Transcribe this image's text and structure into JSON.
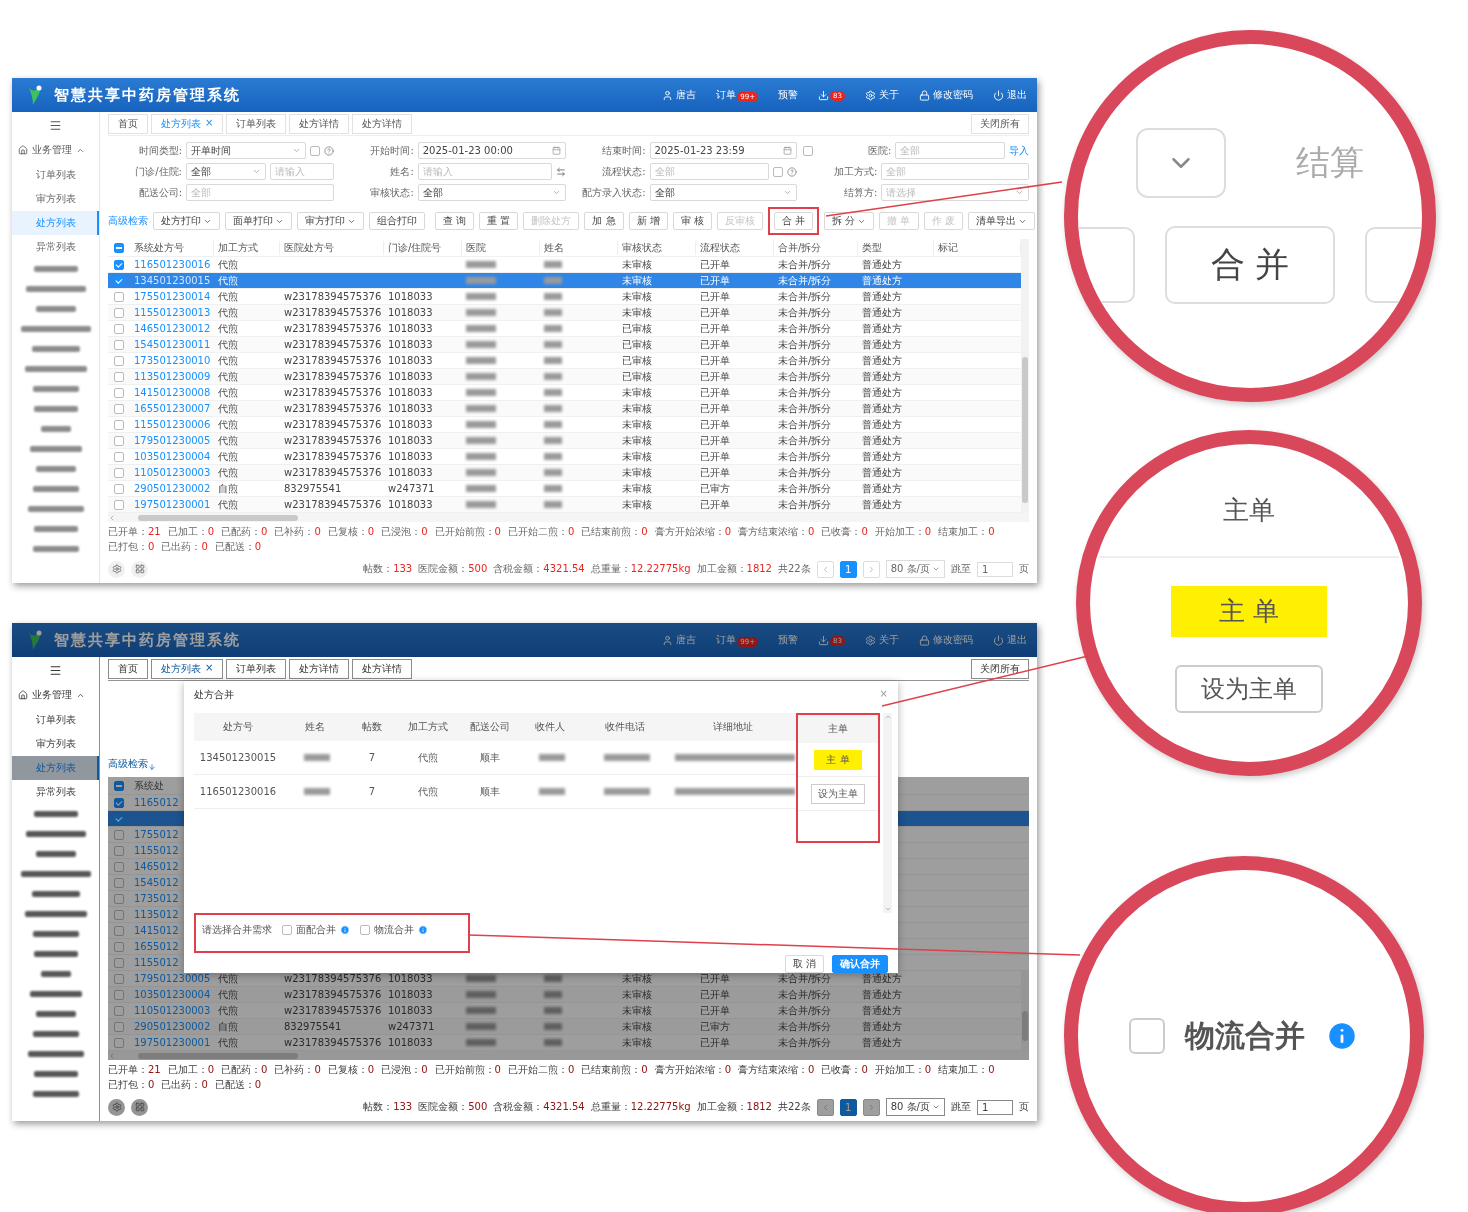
{
  "screenshots": [
    {
      "header": {
        "title": "智慧共享中药房管理系统",
        "items": [
          {
            "kind": "user",
            "label": "唐吉"
          },
          {
            "kind": "text",
            "label": "订单",
            "badge": "99+"
          },
          {
            "kind": "text",
            "label": "预警"
          },
          {
            "kind": "download",
            "badge": "83"
          },
          {
            "kind": "about",
            "label": "关于"
          },
          {
            "kind": "password",
            "label": "修改密码"
          },
          {
            "kind": "logout",
            "label": "退出"
          }
        ]
      },
      "sidebar": {
        "group": {
          "label": "业务管理",
          "expanded": true
        },
        "items": [
          {
            "label": "订单列表",
            "selected": false
          },
          {
            "label": "审方列表",
            "selected": false
          },
          {
            "label": "处方列表",
            "selected": true
          },
          {
            "label": "异常列表",
            "selected": false
          }
        ]
      },
      "tabs": [
        {
          "label": "首页",
          "selected": false
        },
        {
          "label": "处方列表",
          "selected": true,
          "close": "×"
        },
        {
          "label": "订单列表",
          "selected": false
        },
        {
          "label": "处方详情",
          "selected": false
        },
        {
          "label": "处方详情",
          "selected": false
        }
      ],
      "close_all": "关闭所有",
      "filters": [
        [
          {
            "label": "时间类型:",
            "kind": "select",
            "value": "开单时间",
            "extras": [
              {
                "kind": "checkbox",
                "checked": false
              },
              {
                "kind": "help"
              }
            ]
          },
          {
            "label": "开始时间:",
            "kind": "date",
            "value": "2025-01-23 00:00"
          },
          {
            "label": "结束时间:",
            "kind": "date",
            "value": "2025-01-23 23:59"
          },
          {
            "label": "医院:",
            "lead_checkbox": {
              "checked": false
            },
            "kind": "input",
            "placeholder": "全部",
            "extras": [
              {
                "kind": "link",
                "label": "导入"
              }
            ]
          }
        ],
        [
          {
            "label": "门诊/住院:",
            "kind": "select",
            "value": "全部",
            "extras": [
              {
                "kind": "input",
                "placeholder": "请输入"
              }
            ]
          },
          {
            "label": "姓名:",
            "kind": "input",
            "placeholder": "请输入",
            "extras": [
              {
                "kind": "swap"
              }
            ]
          },
          {
            "label": "流程状态:",
            "kind": "input",
            "placeholder": "全部",
            "extras": [
              {
                "kind": "checkbox",
                "checked": false
              },
              {
                "kind": "help"
              }
            ]
          },
          {
            "label": "加工方式:",
            "kind": "input",
            "placeholder": "全部"
          }
        ],
        [
          {
            "label": "配送公司:",
            "kind": "input",
            "placeholder": "全部"
          },
          {
            "label": "审核状态:",
            "kind": "select",
            "value": "全部"
          },
          {
            "label": "配方录入状态:",
            "kind": "select",
            "value": "全部"
          },
          {
            "label": "结算方:",
            "kind": "select",
            "placeholder": "请选择"
          }
        ]
      ],
      "toolbar": {
        "advanced": "高级检索",
        "left": [
          {
            "label": "处方打印",
            "dropdown": true
          },
          {
            "label": "面单打印",
            "dropdown": true
          },
          {
            "label": "审方打印",
            "dropdown": true
          },
          {
            "label": "组合打印",
            "dropdown": false
          }
        ],
        "right": [
          {
            "label": "查 询",
            "disabled": false
          },
          {
            "label": "重 置",
            "disabled": false
          },
          {
            "label": "删除处方",
            "disabled": true
          },
          {
            "label": "加 急",
            "disabled": false
          },
          {
            "label": "新 增",
            "disabled": false
          },
          {
            "label": "审 核",
            "disabled": false
          },
          {
            "label": "反审核",
            "disabled": true
          },
          {
            "label": "合 并",
            "disabled": false,
            "highlight": true
          },
          {
            "label": "拆 分",
            "disabled": false,
            "dropdown": true
          },
          {
            "label": "撤 单",
            "disabled": true
          },
          {
            "label": "作 废",
            "disabled": true
          },
          {
            "label": "清单导出",
            "disabled": false,
            "dropdown": true
          }
        ]
      },
      "table": {
        "indeterminate": true,
        "columns": [
          "系统处方号",
          "加工方式",
          "医院处方号",
          "门诊/住院号",
          "医院",
          "姓名",
          "审核状态",
          "流程状态",
          "合并/拆分",
          "类型",
          "标记"
        ],
        "rows": [
          {
            "id": "116501230016",
            "method": "代煎",
            "audit": "未审核",
            "flow": "已开单",
            "merge": "未合并/拆分",
            "type": "普通处方",
            "checked": true,
            "selected": false
          },
          {
            "id": "134501230015",
            "method": "代煎",
            "audit": "未审核",
            "flow": "已开单",
            "merge": "未合并/拆分",
            "type": "普通处方",
            "checked": true,
            "selected": true
          },
          {
            "id": "175501230014",
            "method": "代煎",
            "hosp_no": "w23178394575376",
            "visit_no": "1018033",
            "audit": "未审核",
            "flow": "已开单",
            "merge": "未合并/拆分",
            "type": "普通处方",
            "checked": false,
            "selected": false
          },
          {
            "id": "115501230013",
            "method": "代煎",
            "hosp_no": "w23178394575376",
            "visit_no": "1018033",
            "audit": "未审核",
            "flow": "已开单",
            "merge": "未合并/拆分",
            "type": "普通处方",
            "checked": false,
            "selected": false
          },
          {
            "id": "146501230012",
            "method": "代煎",
            "hosp_no": "w23178394575376",
            "visit_no": "1018033",
            "audit": "已审核",
            "flow": "已开单",
            "merge": "未合并/拆分",
            "type": "普通处方",
            "checked": false,
            "selected": false
          },
          {
            "id": "154501230011",
            "method": "代煎",
            "hosp_no": "w23178394575376",
            "visit_no": "1018033",
            "audit": "已审核",
            "flow": "已开单",
            "merge": "未合并/拆分",
            "type": "普通处方",
            "checked": false,
            "selected": false
          },
          {
            "id": "173501230010",
            "method": "代煎",
            "hosp_no": "w23178394575376",
            "visit_no": "1018033",
            "audit": "已审核",
            "flow": "已开单",
            "merge": "未合并/拆分",
            "type": "普通处方",
            "checked": false,
            "selected": false
          },
          {
            "id": "113501230009",
            "method": "代煎",
            "hosp_no": "w23178394575376",
            "visit_no": "1018033",
            "audit": "已审核",
            "flow": "已开单",
            "merge": "未合并/拆分",
            "type": "普通处方",
            "checked": false,
            "selected": false
          },
          {
            "id": "141501230008",
            "method": "代煎",
            "hosp_no": "w23178394575376",
            "visit_no": "1018033",
            "audit": "未审核",
            "flow": "已开单",
            "merge": "未合并/拆分",
            "type": "普通处方",
            "checked": false,
            "selected": false
          },
          {
            "id": "165501230007",
            "method": "代煎",
            "hosp_no": "w23178394575376",
            "visit_no": "1018033",
            "audit": "未审核",
            "flow": "已开单",
            "merge": "未合并/拆分",
            "type": "普通处方",
            "checked": false,
            "selected": false
          },
          {
            "id": "115501230006",
            "method": "代煎",
            "hosp_no": "w23178394575376",
            "visit_no": "1018033",
            "audit": "未审核",
            "flow": "已开单",
            "merge": "未合并/拆分",
            "type": "普通处方",
            "checked": false,
            "selected": false
          },
          {
            "id": "179501230005",
            "method": "代煎",
            "hosp_no": "w23178394575376",
            "visit_no": "1018033",
            "audit": "未审核",
            "flow": "已开单",
            "merge": "未合并/拆分",
            "type": "普通处方",
            "checked": false,
            "selected": false
          },
          {
            "id": "103501230004",
            "method": "代煎",
            "hosp_no": "w23178394575376",
            "visit_no": "1018033",
            "audit": "未审核",
            "flow": "已开单",
            "merge": "未合并/拆分",
            "type": "普通处方",
            "checked": false,
            "selected": false
          },
          {
            "id": "110501230003",
            "method": "代煎",
            "hosp_no": "w23178394575376",
            "visit_no": "1018033",
            "audit": "未审核",
            "flow": "已开单",
            "merge": "未合并/拆分",
            "type": "普通处方",
            "checked": false,
            "selected": false
          },
          {
            "id": "290501230002",
            "method": "自煎",
            "hosp_no": "832975541",
            "visit_no": "w247371",
            "audit": "未审核",
            "flow": "已审方",
            "merge": "未合并/拆分",
            "type": "普通处方",
            "checked": false,
            "selected": false
          },
          {
            "id": "197501230001",
            "method": "代煎",
            "hosp_no": "w23178394575376",
            "visit_no": "1018033",
            "audit": "未审核",
            "flow": "已开单",
            "merge": "未合并/拆分",
            "type": "普通处方",
            "checked": false,
            "selected": false
          }
        ]
      },
      "summary": [
        {
          "label": "已开单：",
          "value": "21"
        },
        {
          "label": "已加工：",
          "value": "0"
        },
        {
          "label": "已配药：",
          "value": "0"
        },
        {
          "label": "已补药：",
          "value": "0"
        },
        {
          "label": "已复核：",
          "value": "0"
        },
        {
          "label": "已浸泡：",
          "value": "0"
        },
        {
          "label": "已开始前煎：",
          "value": "0"
        },
        {
          "label": "已开始二煎：",
          "value": "0"
        },
        {
          "label": "已结束前煎：",
          "value": "0"
        },
        {
          "label": "膏方开始浓缩：",
          "value": "0"
        },
        {
          "label": "膏方结束浓缩：",
          "value": "0"
        },
        {
          "label": "已收膏：",
          "value": "0"
        },
        {
          "label": "开始加工：",
          "value": "0"
        },
        {
          "label": "结束加工：",
          "value": "0"
        },
        {
          "label": "已打包：",
          "value": "0"
        },
        {
          "label": "已出药：",
          "value": "0"
        },
        {
          "label": "已配送：",
          "value": "0"
        }
      ],
      "footer": {
        "stats": [
          {
            "label": "帖数：",
            "value": "133"
          },
          {
            "label": "医院金额：",
            "value": "500"
          },
          {
            "label": "含税金额：",
            "value": "4321.54"
          },
          {
            "label": "总重量：",
            "value": "12.22775kg"
          },
          {
            "label": "加工金额：",
            "value": "1812"
          }
        ],
        "total": "共22条",
        "page": "1",
        "page_size": "80 条/页",
        "jump_label": "跳至",
        "jump_value": "1",
        "jump_unit": "页"
      }
    },
    {
      "header": {
        "title": "智慧共享中药房管理系统",
        "items": [
          {
            "kind": "user",
            "label": "唐吉"
          },
          {
            "kind": "text",
            "label": "订单",
            "badge": "99+"
          },
          {
            "kind": "text",
            "label": "预警"
          },
          {
            "kind": "download",
            "badge": "83"
          },
          {
            "kind": "about",
            "label": "关于"
          },
          {
            "kind": "password",
            "label": "修改密码"
          },
          {
            "kind": "logout",
            "label": "退出"
          }
        ]
      },
      "sidebar": {
        "group": {
          "label": "业务管理",
          "expanded": true
        },
        "items": [
          {
            "label": "订单列表",
            "selected": false
          },
          {
            "label": "审方列表",
            "selected": false
          },
          {
            "label": "处方列表",
            "selected": true
          },
          {
            "label": "异常列表",
            "selected": false
          }
        ]
      },
      "tabs": [
        {
          "label": "首页",
          "selected": false
        },
        {
          "label": "处方列表",
          "selected": true,
          "close": "×"
        },
        {
          "label": "订单列表",
          "selected": false
        },
        {
          "label": "处方详情",
          "selected": false
        },
        {
          "label": "处方详情",
          "selected": false
        }
      ],
      "close_all": "关闭所有",
      "covered": {
        "advanced": "高级检索",
        "header_fragment": "系统处",
        "rows": [
          {
            "id": "1165012",
            "checked": true,
            "selected": false
          },
          {
            "checked": true,
            "selected": true
          },
          {
            "id": "1755012",
            "checked": false,
            "selected": false
          },
          {
            "id": "1155012",
            "checked": false,
            "selected": false
          },
          {
            "id": "1465012",
            "checked": false,
            "selected": false
          },
          {
            "id": "1545012",
            "checked": false,
            "selected": false
          },
          {
            "id": "1735012",
            "checked": false,
            "selected": false
          },
          {
            "id": "1135012",
            "checked": false,
            "selected": false
          },
          {
            "id": "1415012",
            "checked": false,
            "selected": false
          },
          {
            "id": "1655012",
            "checked": false,
            "selected": false
          },
          {
            "id": "1155012",
            "checked": false,
            "selected": false
          }
        ]
      },
      "table": {
        "rows": [
          {
            "id": "179501230005",
            "method": "代煎",
            "hosp_no": "w23178394575376",
            "visit_no": "1018033",
            "audit": "未审核",
            "flow": "已开单",
            "merge": "未合并/拆分",
            "type": "普通处方",
            "checked": false,
            "selected": false
          },
          {
            "id": "103501230004",
            "method": "代煎",
            "hosp_no": "w23178394575376",
            "visit_no": "1018033",
            "audit": "未审核",
            "flow": "已开单",
            "merge": "未合并/拆分",
            "type": "普通处方",
            "checked": false,
            "selected": false
          },
          {
            "id": "110501230003",
            "method": "代煎",
            "hosp_no": "w23178394575376",
            "visit_no": "1018033",
            "audit": "未审核",
            "flow": "已开单",
            "merge": "未合并/拆分",
            "type": "普通处方",
            "checked": false,
            "selected": false
          },
          {
            "id": "290501230002",
            "method": "自煎",
            "hosp_no": "832975541",
            "visit_no": "w247371",
            "audit": "未审核",
            "flow": "已审方",
            "merge": "未合并/拆分",
            "type": "普通处方",
            "checked": false,
            "selected": false
          },
          {
            "id": "197501230001",
            "method": "代煎",
            "hosp_no": "w23178394575376",
            "visit_no": "1018033",
            "audit": "未审核",
            "flow": "已开单",
            "merge": "未合并/拆分",
            "type": "普通处方",
            "checked": false,
            "selected": false
          }
        ]
      },
      "summary": [
        {
          "label": "已开单：",
          "value": "21"
        },
        {
          "label": "已加工：",
          "value": "0"
        },
        {
          "label": "已配药：",
          "value": "0"
        },
        {
          "label": "已补药：",
          "value": "0"
        },
        {
          "label": "已复核：",
          "value": "0"
        },
        {
          "label": "已浸泡：",
          "value": "0"
        },
        {
          "label": "已开始前煎：",
          "value": "0"
        },
        {
          "label": "已开始二煎：",
          "value": "0"
        },
        {
          "label": "已结束前煎：",
          "value": "0"
        },
        {
          "label": "膏方开始浓缩：",
          "value": "0"
        },
        {
          "label": "膏方结束浓缩：",
          "value": "0"
        },
        {
          "label": "已收膏：",
          "value": "0"
        },
        {
          "label": "开始加工：",
          "value": "0"
        },
        {
          "label": "结束加工：",
          "value": "0"
        },
        {
          "label": "已打包：",
          "value": "0"
        },
        {
          "label": "已出药：",
          "value": "0"
        },
        {
          "label": "已配送：",
          "value": "0"
        }
      ],
      "footer": {
        "stats": [
          {
            "label": "帖数：",
            "value": "133"
          },
          {
            "label": "医院金额：",
            "value": "500"
          },
          {
            "label": "含税金额：",
            "value": "4321.54"
          },
          {
            "label": "总重量：",
            "value": "12.22775kg"
          },
          {
            "label": "加工金额：",
            "value": "1812"
          }
        ],
        "total": "共22条",
        "page": "1",
        "page_size": "80 条/页",
        "jump_label": "跳至",
        "jump_value": "1",
        "jump_unit": "页"
      },
      "modal": {
        "title": "处方合并",
        "close": "×",
        "columns": [
          "处方号",
          "姓名",
          "帖数",
          "加工方式",
          "配送公司",
          "收件人",
          "收件电话",
          "详细地址"
        ],
        "main_column": "主单",
        "highlight_main": true,
        "rows": [
          {
            "id": "134501230015",
            "count": "7",
            "method": "代煎",
            "carrier": "顺丰",
            "main": true,
            "main_label": "主 单"
          },
          {
            "id": "116501230016",
            "count": "7",
            "method": "代煎",
            "carrier": "顺丰",
            "main": false,
            "main_label": "设为主单"
          }
        ],
        "options_label": "请选择合并需求",
        "highlight_options": true,
        "options": [
          {
            "label": "面配合并",
            "checked": false
          },
          {
            "label": "物流合并",
            "checked": false
          }
        ],
        "cancel": "取 消",
        "confirm": "确认合并"
      }
    }
  ],
  "callouts": [
    {
      "kind": "merge",
      "field_label": "结算",
      "button": "合 并"
    },
    {
      "kind": "main",
      "header": "主单",
      "badge": "主 单",
      "button": "设为主单"
    },
    {
      "kind": "logistics",
      "checked": false,
      "label": "物流合并"
    }
  ]
}
